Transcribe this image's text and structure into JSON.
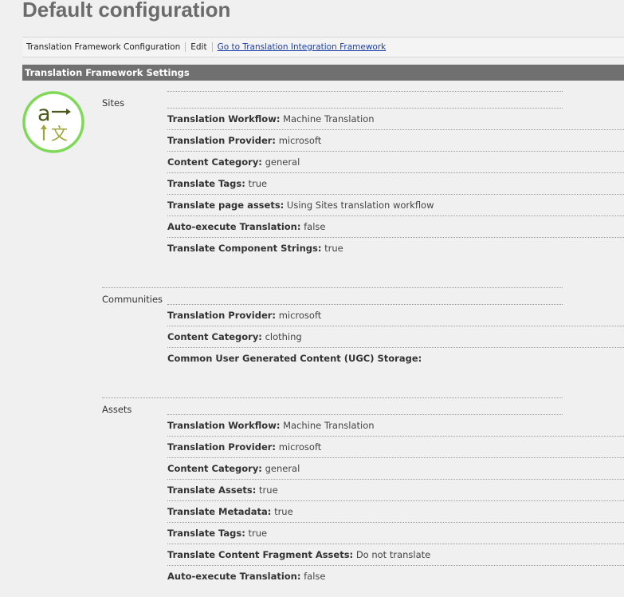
{
  "page": {
    "title": "Default configuration"
  },
  "tabs": [
    {
      "label": "Translation Framework Configuration"
    },
    {
      "label": "Edit"
    },
    {
      "label": "Go to Translation Integration Framework"
    }
  ],
  "section": {
    "title": "Translation Framework Settings"
  },
  "logo": {
    "icon": "translation-icon",
    "letter_latin": "a",
    "letter_cjk": "文",
    "ring_color": "#7ed957",
    "glyph_color": "#4b5a1a"
  },
  "groups": {
    "sites": {
      "label": "Sites",
      "rows": [
        {
          "key": "Translation Workflow:",
          "value": "Machine Translation"
        },
        {
          "key": "Translation Provider:",
          "value": "microsoft"
        },
        {
          "key": "Content Category:",
          "value": "general"
        },
        {
          "key": "Translate Tags:",
          "value": "true"
        },
        {
          "key": "Translate page assets:",
          "value": "Using Sites translation workflow"
        },
        {
          "key": "Auto-execute Translation:",
          "value": "false"
        },
        {
          "key": "Translate Component Strings:",
          "value": "true"
        }
      ]
    },
    "communities": {
      "label": "Communities",
      "rows": [
        {
          "key": "Translation Provider:",
          "value": "microsoft"
        },
        {
          "key": "Content Category:",
          "value": "clothing"
        },
        {
          "key": "Common User Generated Content (UGC) Storage:",
          "value": ""
        }
      ]
    },
    "assets": {
      "label": "Assets",
      "rows": [
        {
          "key": "Translation Workflow:",
          "value": "Machine Translation"
        },
        {
          "key": "Translation Provider:",
          "value": "microsoft"
        },
        {
          "key": "Content Category:",
          "value": "general"
        },
        {
          "key": "Translate Assets:",
          "value": "true"
        },
        {
          "key": "Translate Metadata:",
          "value": "true"
        },
        {
          "key": "Translate Tags:",
          "value": "true"
        },
        {
          "key": "Translate Content Fragment Assets:",
          "value": "Do not translate"
        },
        {
          "key": "Auto-execute Translation:",
          "value": "false"
        }
      ]
    }
  }
}
